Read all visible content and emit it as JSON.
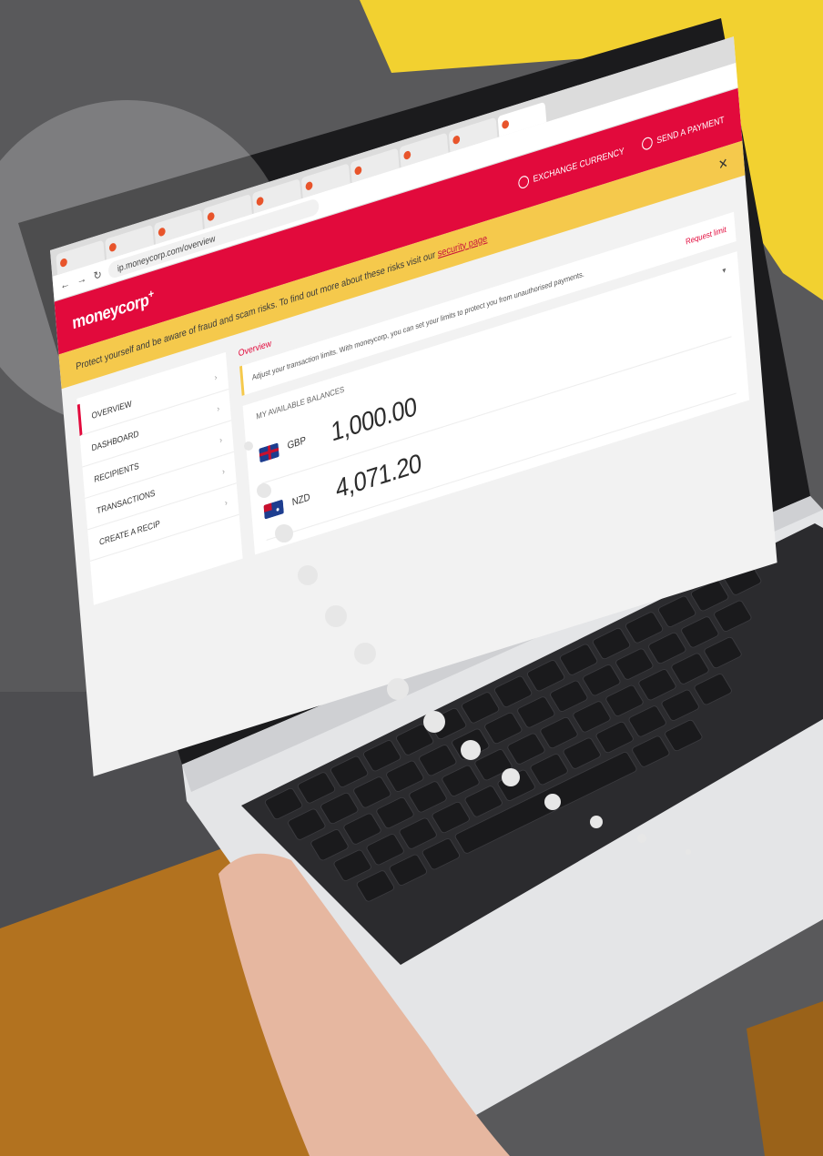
{
  "browser": {
    "url": "ip.moneycorp.com/overview",
    "tabs": [
      "",
      "",
      "",
      "",
      "",
      "",
      "",
      "",
      "",
      ""
    ]
  },
  "topbar": {
    "brand": "moneycorp",
    "actions": [
      {
        "label": "EXCHANGE CURRENCY",
        "icon": "exchange-icon"
      },
      {
        "label": "SEND A PAYMENT",
        "icon": "send-icon"
      }
    ]
  },
  "banner": {
    "text": "Protect yourself and be aware of fraud and scam risks. To find out more about these risks visit our",
    "link": "security page"
  },
  "breadcrumb": "Overview",
  "notice": {
    "text": "Adjust your transaction limits. With moneycorp, you can set your limits to protect you from unauthorised payments.",
    "link": "Request limit"
  },
  "sidebar": {
    "items": [
      {
        "label": "OVERVIEW"
      },
      {
        "label": "DASHBOARD"
      },
      {
        "label": "RECIPIENTS"
      },
      {
        "label": "TRANSACTIONS"
      },
      {
        "label": "CREATE A RECIP"
      }
    ]
  },
  "balances": {
    "title": "MY AVAILABLE BALANCES",
    "rows": [
      {
        "currency": "GBP",
        "amount": "1,000.00"
      },
      {
        "currency": "NZD",
        "amount": "4,071.20"
      }
    ]
  },
  "colors": {
    "brand": "#e20a3c",
    "banner": "#f5c94c",
    "sofa": "#5a5a5c",
    "pillow": "#f2d130",
    "trousers": "#b2721f"
  }
}
